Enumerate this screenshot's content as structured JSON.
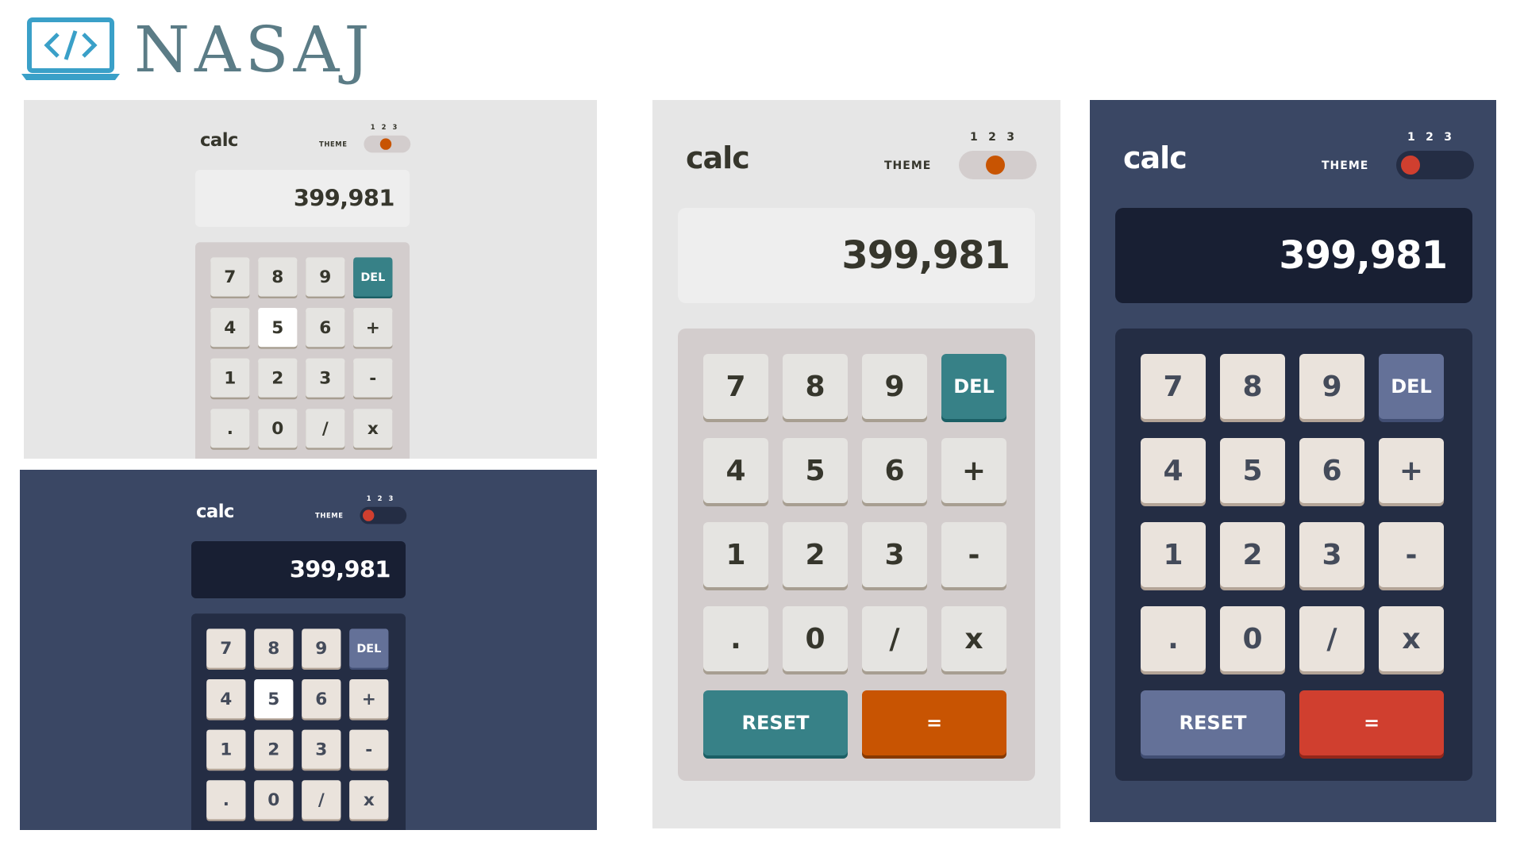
{
  "logo": {
    "text": "NASAJ",
    "icon": "laptop-code-icon"
  },
  "calculator": {
    "brand": "calc",
    "theme_label": "THEME",
    "theme_numbers": [
      "1",
      "2",
      "3"
    ],
    "display_value": "399,981",
    "keys": {
      "k7": "7",
      "k8": "8",
      "k9": "9",
      "del": "DEL",
      "k4": "4",
      "k5": "5",
      "k6": "6",
      "plus": "+",
      "k1": "1",
      "k2": "2",
      "k3": "3",
      "minus": "-",
      "dot": ".",
      "k0": "0",
      "div": "/",
      "mul": "x",
      "reset": "RESET",
      "equals": "="
    }
  },
  "colors": {
    "light_page": "#e6e6e6",
    "dark_page": "#3a4764",
    "light_accent": "#378187",
    "light_equals": "#c85402",
    "dark_accent": "#647198",
    "dark_equals": "#d03f2f",
    "logo": "#5b7c86"
  },
  "panels": [
    {
      "theme": "light",
      "highlighted_key": "5",
      "active_theme": "2"
    },
    {
      "theme": "dark",
      "highlighted_key": "5",
      "active_theme": "1"
    },
    {
      "theme": "light",
      "highlighted_key": "",
      "active_theme": "2"
    },
    {
      "theme": "dark",
      "highlighted_key": "",
      "active_theme": "1"
    }
  ]
}
